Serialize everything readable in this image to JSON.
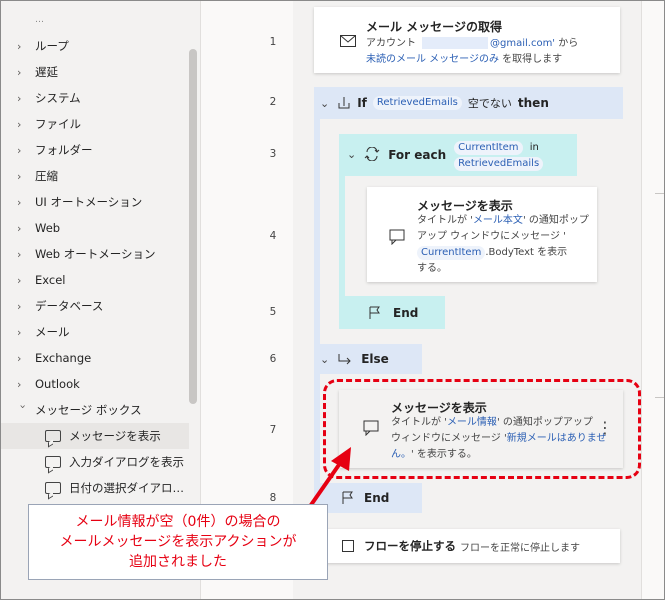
{
  "sidebar": {
    "items": [
      {
        "label": "ループ"
      },
      {
        "label": "遅延"
      },
      {
        "label": "システム"
      },
      {
        "label": "ファイル"
      },
      {
        "label": "フォルダー"
      },
      {
        "label": "圧縮"
      },
      {
        "label": "UI オートメーション"
      },
      {
        "label": "Web"
      },
      {
        "label": "Web オートメーション"
      },
      {
        "label": "Excel"
      },
      {
        "label": "データベース"
      },
      {
        "label": "メール"
      },
      {
        "label": "Exchange"
      },
      {
        "label": "Outlook"
      },
      {
        "label": "メッセージ ボックス"
      }
    ],
    "sub_items": [
      {
        "label": "メッセージを表示"
      },
      {
        "label": "入力ダイアログを表示"
      },
      {
        "label": "日付の選択ダイアロ…"
      }
    ]
  },
  "line_numbers": [
    "1",
    "2",
    "3",
    "4",
    "5",
    "6",
    "7",
    "8"
  ],
  "flow": {
    "step1": {
      "title": "メール メッセージの取得",
      "desc_account_prefix": "アカウント",
      "desc_account_email": "@gmail.com'",
      "desc_account_suffix": " から",
      "desc_unread": "未読のメール メッセージのみ",
      "desc_end": " を取得します"
    },
    "step2": {
      "kw_if": "If",
      "var": "RetrievedEmails",
      "cond": "空でない",
      "kw_then": "then"
    },
    "step3": {
      "kw_for": "For each",
      "var_item": "CurrentItem",
      "kw_in": "in",
      "var_list": "RetrievedEmails"
    },
    "step4": {
      "title": "メッセージを表示",
      "d1": "タイトルが '",
      "d1_link": "メール本文",
      "d1_end": "' の通知ポップ",
      "d2": "アップ ウィンドウにメッセージ '",
      "d3_var": "CurrentItem",
      "d3_end": ".BodyText を表示",
      "d4": "する。"
    },
    "step5": {
      "label": "End"
    },
    "step6": {
      "label": "Else"
    },
    "step7": {
      "title": "メッセージを表示",
      "d1": "タイトルが '",
      "d1_link": "メール情報",
      "d1_end": "' の通知ポップアップ",
      "d2": "ウィンドウにメッセージ '",
      "d2_link": "新規メールはありませ",
      "d3_link": "ん。",
      "d3_end": "' を表示する。",
      "menu": "⋮"
    },
    "step8": {
      "label": "End"
    },
    "stop": {
      "title": "フローを停止する",
      "desc": "フローを正常に停止します"
    }
  },
  "annotation": {
    "line1": "メール情報が空（0件）の場合の",
    "line2": "メールメッセージを表示アクションが",
    "line3": "追加されました"
  },
  "colors": {
    "annotation": "#e60012",
    "if_block": "#dde7f6",
    "loop_block": "#c8f0f0",
    "link": "#2b5fb4"
  }
}
